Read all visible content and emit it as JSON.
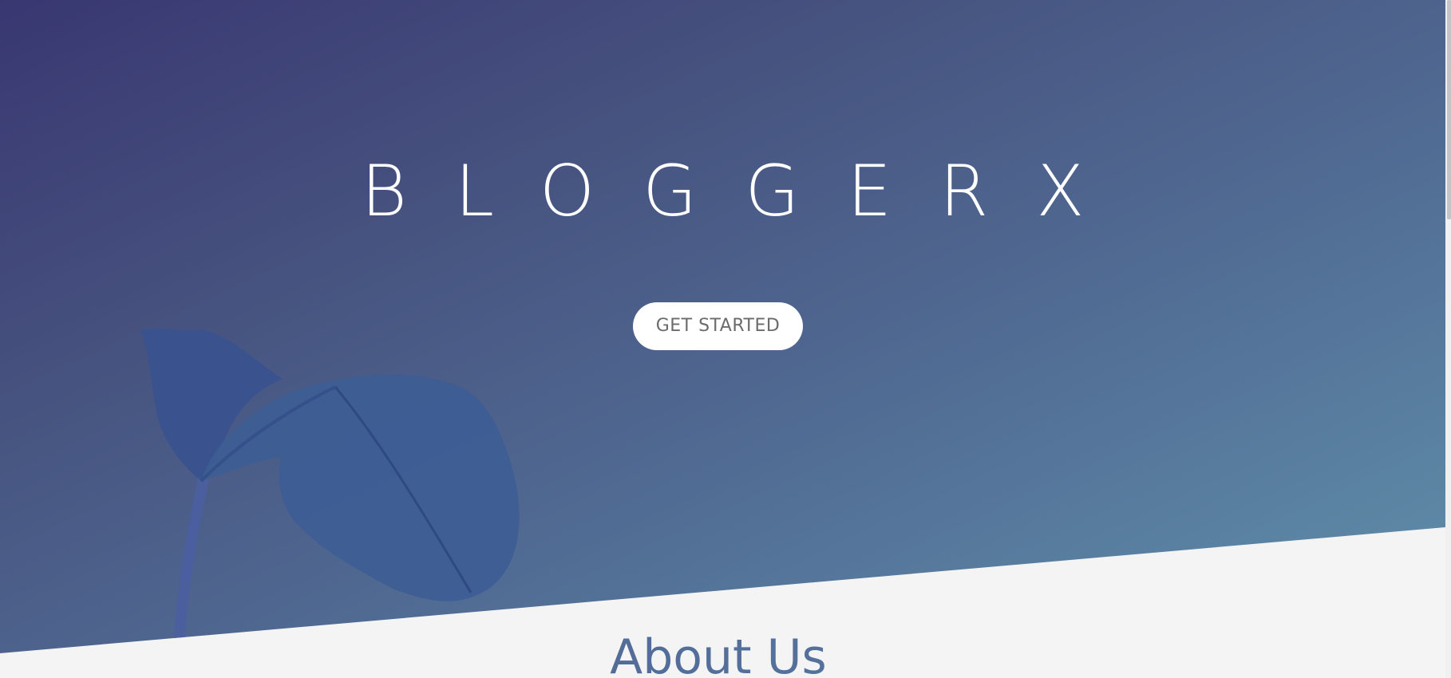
{
  "hero": {
    "brand": "BLOGGERX",
    "cta_label": "GET STARTED",
    "background_image": "plant-leaf-illustration",
    "gradient_colors": [
      "#393771",
      "#516c94",
      "#6192ac"
    ]
  },
  "about": {
    "heading": "About Us"
  },
  "colors": {
    "page_background": "#f4f4f5",
    "button_background": "#ffffff",
    "button_text": "#6b6b6b"
  }
}
